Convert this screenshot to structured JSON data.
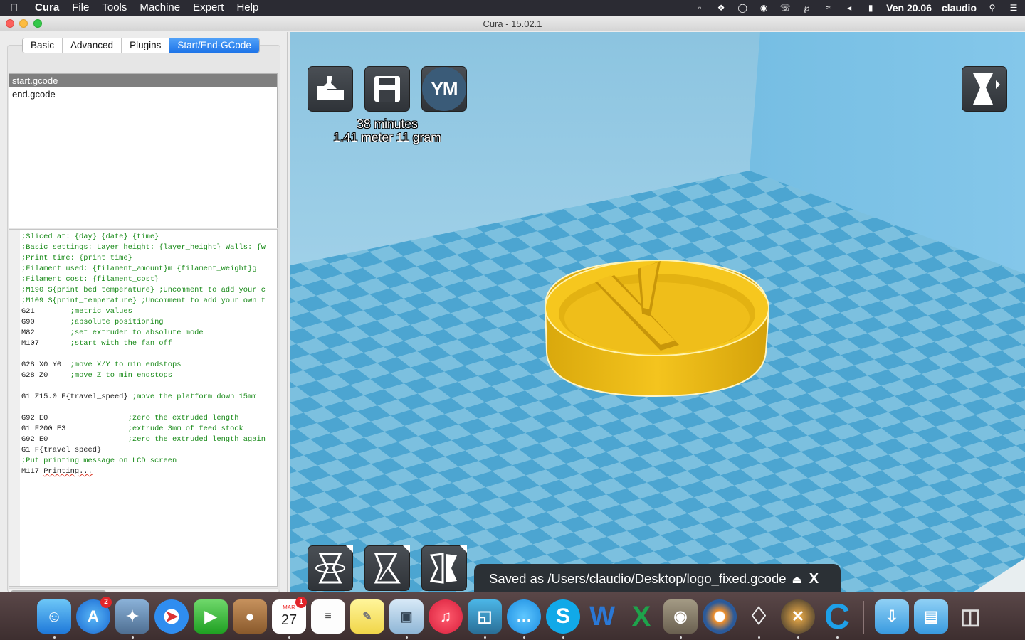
{
  "menubar": {
    "app": "Cura",
    "menus": [
      "File",
      "Tools",
      "Machine",
      "Expert",
      "Help"
    ],
    "clock": "Ven 20.06",
    "user": "claudio"
  },
  "window": {
    "title": "Cura - 15.02.1"
  },
  "tabs": [
    "Basic",
    "Advanced",
    "Plugins",
    "Start/End-GCode"
  ],
  "active_tab": "Start/End-GCode",
  "files": [
    "start.gcode",
    "end.gcode"
  ],
  "selected_file": "start.gcode",
  "gcode_lines": [
    ";Sliced at: {day} {date} {time}",
    ";Basic settings: Layer height: {layer_height} Walls: {w",
    ";Print time: {print_time}",
    ";Filament used: {filament_amount}m {filament_weight}g",
    ";Filament cost: {filament_cost}",
    ";M190 S{print_bed_temperature} ;Uncomment to add your c",
    ";M109 S{print_temperature} ;Uncomment to add your own t",
    "G21        ;metric values",
    "G90        ;absolute positioning",
    "M82        ;set extruder to absolute mode",
    "M107       ;start with the fan off",
    "",
    "G28 X0 Y0  ;move X/Y to min endstops",
    "G28 Z0     ;move Z to min endstops",
    "",
    "G1 Z15.0 F{travel_speed} ;move the platform down 15mm",
    "",
    "G92 E0                  ;zero the extruded length",
    "G1 F200 E3              ;extrude 3mm of feed stock",
    "G92 E0                  ;zero the extruded length again",
    "G1 F{travel_speed}",
    ";Put printing message on LCD screen",
    "M117 Printing..."
  ],
  "viewport": {
    "print_time": "38 minutes",
    "print_material": "1.41 meter 11 gram",
    "ym_label": "YM",
    "notification": "Saved as /Users/claudio/Desktop/logo_fixed.gcode",
    "notification_close": "X"
  },
  "dock": {
    "app_store_badge": "2",
    "calendar_month": "MAR",
    "calendar_day": "27",
    "calendar_badge": "1"
  },
  "colors": {
    "model": "#f2c21c",
    "sky": "#7fc3e6",
    "floor_light": "#7dc1e0",
    "floor_dark": "#4ea6d2",
    "tab_active": "#2a7bea"
  }
}
